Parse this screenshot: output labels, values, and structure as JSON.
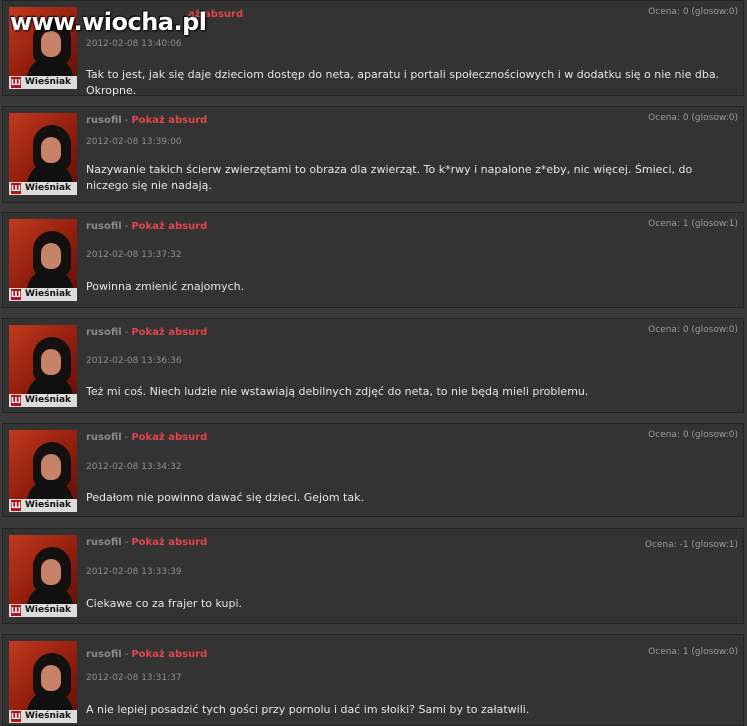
{
  "site": {
    "logo": "www.wiocha.pl"
  },
  "comments": [
    {
      "author": "",
      "separator": "",
      "report_label": "aż absurd",
      "date": "2012-02-08 13:40:06",
      "rating": "Ocena: 0 (glosow:0)",
      "rank": "Wieśniak",
      "text": "Tak to jest, jak się daje dzieciom dostęp do neta, aparatu i portali społecznościowych i w dodatku się o nie nie dba. Okropne."
    },
    {
      "author": "rusofil",
      "separator": "-",
      "report_label": "Pokaż absurd",
      "date": "2012-02-08 13:39:00",
      "rating": "Ocena: 0 (glosow:0)",
      "rank": "Wieśniak",
      "text": "Nazywanie takich ścierw zwierzętami to obraza dla zwierząt. To k*rwy i napalone z*eby, nic więcej. Śmieci, do niczego się nie nadają."
    },
    {
      "author": "rusofil",
      "separator": "-",
      "report_label": "Pokaż absurd",
      "date": "2012-02-08 13:37:32",
      "rating": "Ocena: 1 (glosow:1)",
      "rank": "Wieśniak",
      "text": "Powinna zmienić znajomych."
    },
    {
      "author": "rusofil",
      "separator": "-",
      "report_label": "Pokaż absurd",
      "date": "2012-02-08 13:36:36",
      "rating": "Ocena: 0 (glosow:0)",
      "rank": "Wieśniak",
      "text": "Też mi coś. Niech ludzie nie wstawiają debilnych zdjęć do neta, to nie będą mieli problemu."
    },
    {
      "author": "rusofil",
      "separator": "-",
      "report_label": "Pokaż absurd",
      "date": "2012-02-08 13:34:32",
      "rating": "Ocena: 0 (glosow:0)",
      "rank": "Wieśniak",
      "text": "Pedałom nie powinno dawać się dzieci. Gejom tak."
    },
    {
      "author": "rusofil",
      "separator": "-",
      "report_label": "Pokaż absurd",
      "date": "2012-02-08 13:33:39",
      "rating": "Ocena: -1 (glosow:1)",
      "rank": "Wieśniak",
      "text": "Ciekawe co za frajer to kupi."
    },
    {
      "author": "rusofil",
      "separator": "-",
      "report_label": "Pokaż absurd",
      "date": "2012-02-08 13:31:37",
      "rating": "Ocena: 1 (glosow:0)",
      "rank": "Wieśniak",
      "text": "A nie lepiej posadzić tych gości przy pornolu i dać im słoiki? Sami by to załatwili."
    }
  ]
}
